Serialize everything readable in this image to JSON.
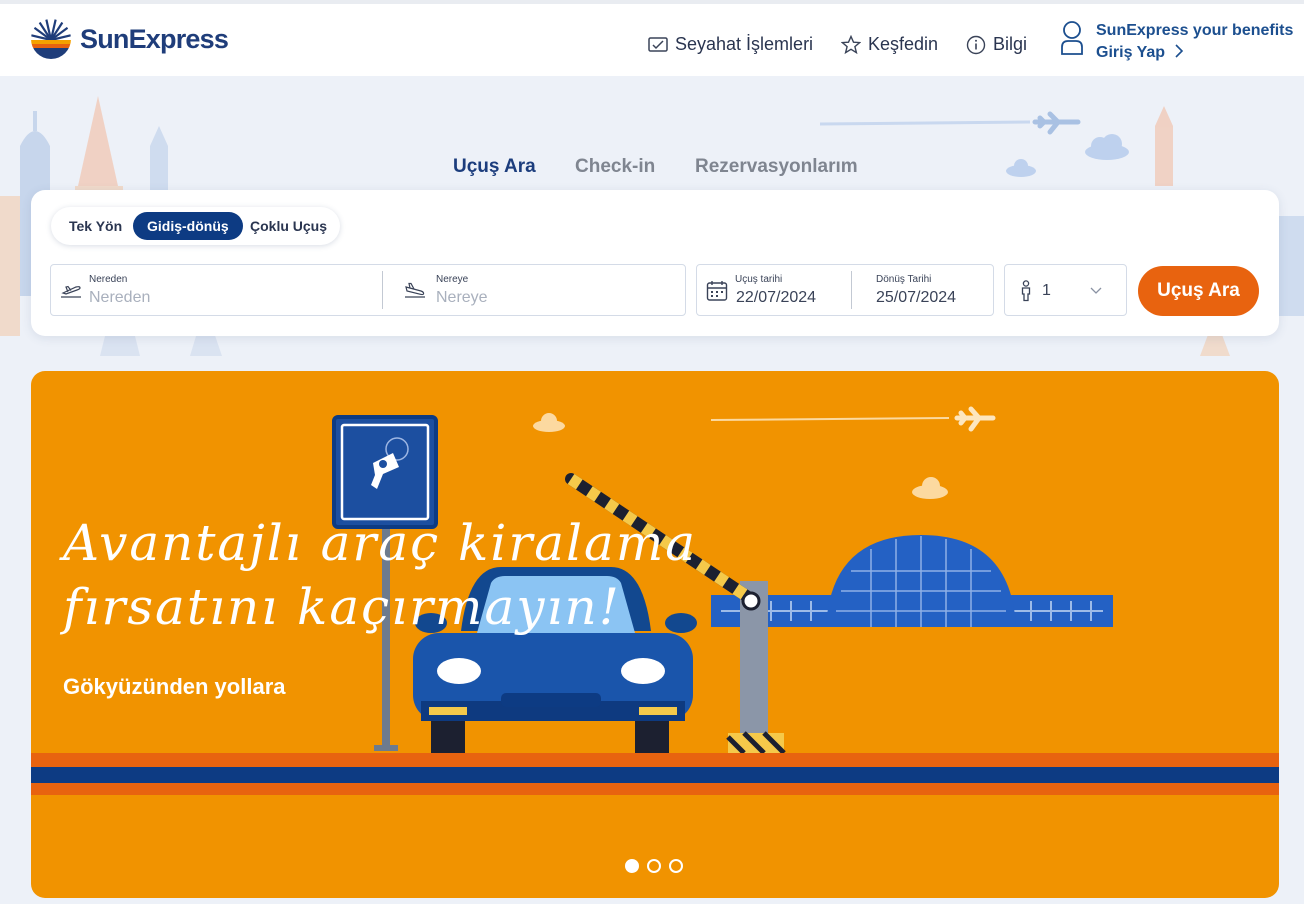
{
  "brand": {
    "name": "SunExpress"
  },
  "nav": {
    "items": [
      {
        "label": "Seyahat İşlemleri",
        "icon": "checkbox-icon"
      },
      {
        "label": "Keşfedin",
        "icon": "star-icon"
      },
      {
        "label": "Bilgi",
        "icon": "info-icon"
      }
    ],
    "benefits_title": "SunExpress your benefits",
    "login_label": "Giriş Yap"
  },
  "tabs": [
    {
      "label": "Uçuş Ara",
      "active": true
    },
    {
      "label": "Check-in",
      "active": false
    },
    {
      "label": "Rezervasyonlarım",
      "active": false
    }
  ],
  "search": {
    "trip_types": [
      {
        "label": "Tek Yön",
        "active": false
      },
      {
        "label": "Gidiş-dönüş",
        "active": true
      },
      {
        "label": "Çoklu Uçuş",
        "active": false
      }
    ],
    "from": {
      "label": "Nereden",
      "placeholder": "Nereden"
    },
    "to": {
      "label": "Nereye",
      "placeholder": "Nereye"
    },
    "depart": {
      "label": "Uçuş tarihi",
      "value": "22/07/2024"
    },
    "return": {
      "label": "Dönüş Tarihi",
      "value": "25/07/2024"
    },
    "passengers": {
      "value": "1"
    },
    "submit_label": "Uçuş Ara"
  },
  "banner": {
    "headline_line1": "Avantajlı araç kiralama",
    "headline_line2": "fırsatını kaçırmayın!",
    "subline": "Gökyüzünden yollara",
    "slides_total": 3,
    "active_slide": 1
  },
  "colors": {
    "brand_navy": "#0d3b83",
    "accent_orange": "#e8630f",
    "banner_orange": "#f19300"
  }
}
